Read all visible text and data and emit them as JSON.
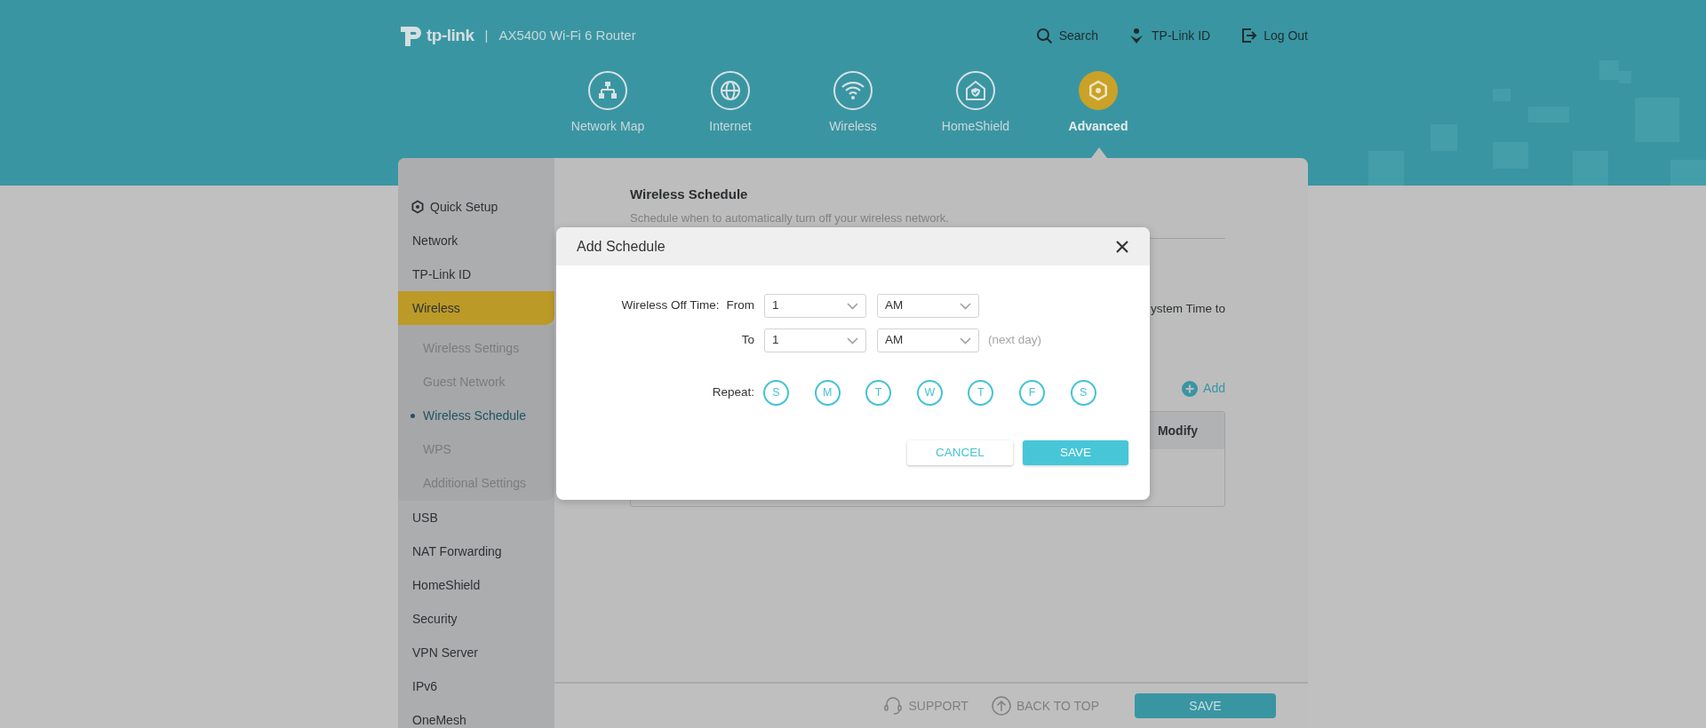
{
  "header": {
    "logo_text": "tp-link",
    "separator": "|",
    "product": "AX5400 Wi-Fi 6 Router",
    "links": [
      {
        "label": "Search",
        "kind": "search"
      },
      {
        "label": "TP-Link ID",
        "kind": "account"
      },
      {
        "label": "Log Out",
        "kind": "logout"
      }
    ]
  },
  "nav_tabs": [
    {
      "label": "Network Map",
      "kind": "network-map",
      "selected": false
    },
    {
      "label": "Internet",
      "kind": "internet",
      "selected": false
    },
    {
      "label": "Wireless",
      "kind": "wireless",
      "selected": false
    },
    {
      "label": "HomeShield",
      "kind": "homeshield",
      "selected": false
    },
    {
      "label": "Advanced",
      "kind": "advanced",
      "selected": true
    }
  ],
  "sidebar": {
    "items": [
      {
        "label": "Quick Setup",
        "kind": "setup",
        "selected": false,
        "expanded": false
      },
      {
        "label": "Network",
        "selected": false,
        "expanded": false
      },
      {
        "label": "TP-Link ID",
        "selected": false,
        "expanded": false
      },
      {
        "label": "Wireless",
        "selected": true,
        "expanded": true,
        "children": [
          {
            "label": "Wireless Settings",
            "selected": false
          },
          {
            "label": "Guest Network",
            "selected": false
          },
          {
            "label": "Wireless Schedule",
            "selected": true
          },
          {
            "label": "WPS",
            "selected": false
          },
          {
            "label": "Additional Settings",
            "selected": false
          }
        ]
      },
      {
        "label": "USB",
        "selected": false,
        "expanded": false
      },
      {
        "label": "NAT Forwarding",
        "selected": false,
        "expanded": false
      },
      {
        "label": "HomeShield",
        "selected": false,
        "expanded": false
      },
      {
        "label": "Security",
        "selected": false,
        "expanded": false
      },
      {
        "label": "VPN Server",
        "selected": false,
        "expanded": false
      },
      {
        "label": "IPv6",
        "selected": false,
        "expanded": false
      },
      {
        "label": "OneMesh",
        "selected": false,
        "expanded": false
      }
    ]
  },
  "content": {
    "title": "Wireless Schedule",
    "description": "Schedule when to automatically turn off your wireless network.",
    "partial_text": "ystem Time to",
    "add_button": "Add",
    "table": {
      "columns": [
        {
          "label": "Modify"
        }
      ]
    }
  },
  "footer": {
    "support": "SUPPORT",
    "back_to_top": "BACK TO TOP",
    "save": "SAVE"
  },
  "modal": {
    "title": "Add Schedule",
    "off_time_label": "Wireless Off Time:",
    "from_label": "From",
    "to_label": "To",
    "from": {
      "hour": "1",
      "period": "AM"
    },
    "to": {
      "hour": "1",
      "period": "AM"
    },
    "to_note": "(next day)",
    "repeat_label": "Repeat:",
    "days": [
      {
        "label": "S",
        "selected": false
      },
      {
        "label": "M",
        "selected": false
      },
      {
        "label": "T",
        "selected": false
      },
      {
        "label": "W",
        "selected": false
      },
      {
        "label": "T",
        "selected": false
      },
      {
        "label": "F",
        "selected": false
      },
      {
        "label": "S",
        "selected": false
      }
    ],
    "buttons": [
      {
        "label": "CANCEL",
        "kind": "secondary"
      },
      {
        "label": "SAVE",
        "kind": "primary"
      }
    ]
  }
}
